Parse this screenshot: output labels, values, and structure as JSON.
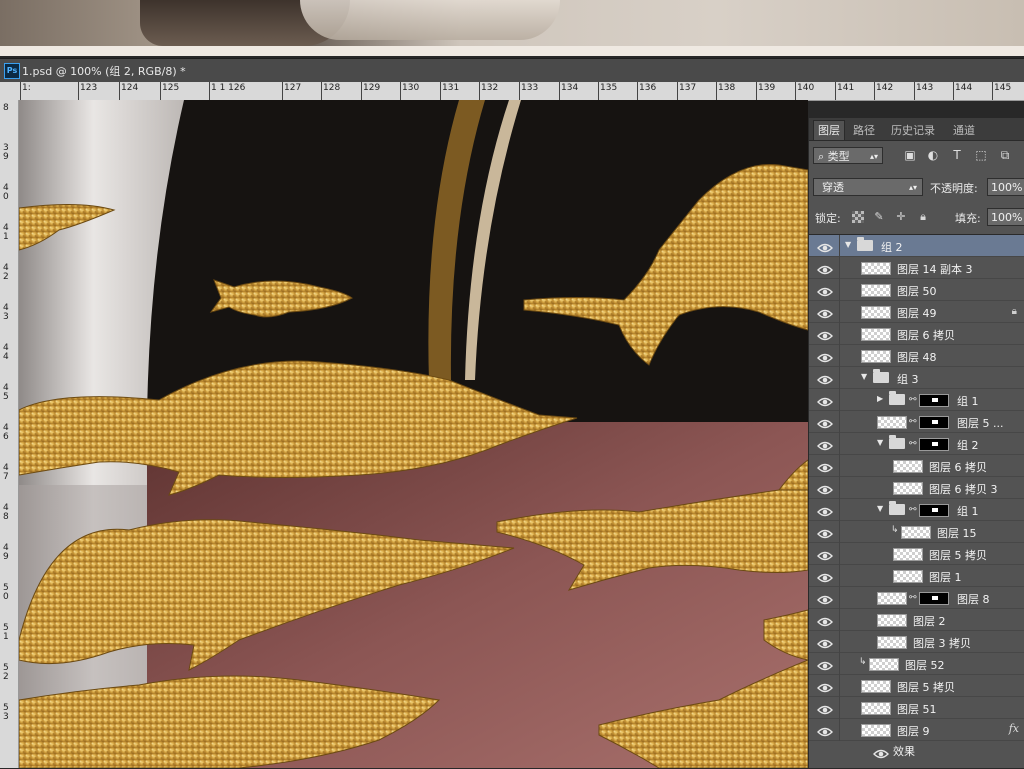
{
  "document": {
    "tab_title": "1.psd @ 100% (组 2, RGB/8) *",
    "app_icon_label": "Ps"
  },
  "ruler": {
    "horizontal_labels": [
      "1:",
      "123",
      "124",
      "125",
      "1 1 126",
      "127",
      "128",
      "129",
      "130",
      "131",
      "132",
      "133",
      "134",
      "135",
      "136",
      "137",
      "138",
      "139",
      "140",
      "141",
      "142",
      "143",
      "144",
      "145"
    ],
    "vertical_labels": [
      "8",
      "3\n9",
      "4\n0",
      "4\n1",
      "4\n2",
      "4\n3",
      "4\n4",
      "4\n5",
      "4\n6",
      "4\n7",
      "4\n8",
      "4\n9",
      "5\n0",
      "5\n1",
      "5\n2",
      "5\n3"
    ]
  },
  "panel": {
    "tabs": [
      "图层",
      "路径",
      "历史记录",
      "通道"
    ],
    "active_tab": "图层",
    "filter_label": "类型",
    "blend_mode": "穿透",
    "opacity_label": "不透明度:",
    "opacity_value": "100%",
    "lock_label": "锁定:",
    "fill_label": "填充:",
    "fill_value": "100%",
    "layers": [
      {
        "name": "组 2",
        "type": "group",
        "indent": 0,
        "expanded": true,
        "selected": true
      },
      {
        "name": "图层 14 副本 3",
        "type": "layer",
        "indent": 1
      },
      {
        "name": "图层 50",
        "type": "layer",
        "indent": 1
      },
      {
        "name": "图层 49",
        "type": "layer",
        "indent": 1,
        "locked": true
      },
      {
        "name": "图层 6 拷贝",
        "type": "layer",
        "indent": 1
      },
      {
        "name": "图层 48",
        "type": "layer",
        "indent": 1
      },
      {
        "name": "组 3",
        "type": "group",
        "indent": 1,
        "expanded": true
      },
      {
        "name": "组 1",
        "type": "group-mask",
        "indent": 2,
        "expanded": false
      },
      {
        "name": "图层 5 ...",
        "type": "layer-mask",
        "indent": 2
      },
      {
        "name": "组 2",
        "type": "group-mask",
        "indent": 2,
        "expanded": true
      },
      {
        "name": "图层 6 拷贝",
        "type": "layer",
        "indent": 3
      },
      {
        "name": "图层 6 拷贝 3",
        "type": "layer",
        "indent": 3
      },
      {
        "name": "组 1",
        "type": "group-mask",
        "indent": 2,
        "expanded": true
      },
      {
        "name": "图层 15",
        "type": "layer",
        "indent": 3,
        "clipped": true
      },
      {
        "name": "图层 5 拷贝",
        "type": "layer",
        "indent": 3
      },
      {
        "name": "图层 1",
        "type": "layer",
        "indent": 3
      },
      {
        "name": "图层 8",
        "type": "layer-mask",
        "indent": 2
      },
      {
        "name": "图层 2",
        "type": "layer",
        "indent": 2
      },
      {
        "name": "图层 3 拷贝",
        "type": "layer",
        "indent": 2
      },
      {
        "name": "图层 52",
        "type": "layer",
        "indent": 1,
        "clipped": true
      },
      {
        "name": "图层 5 拷贝",
        "type": "layer",
        "indent": 1
      },
      {
        "name": "图层 51",
        "type": "layer",
        "indent": 1
      },
      {
        "name": "图层 9",
        "type": "layer",
        "indent": 1,
        "fx": true
      }
    ],
    "effects_label": "效果",
    "fx_label": "fx"
  },
  "colors": {
    "panel_bg": "#535353",
    "selection": "#6a7a93",
    "gold": "#c99a3a",
    "wood_red": "#7a4440"
  }
}
